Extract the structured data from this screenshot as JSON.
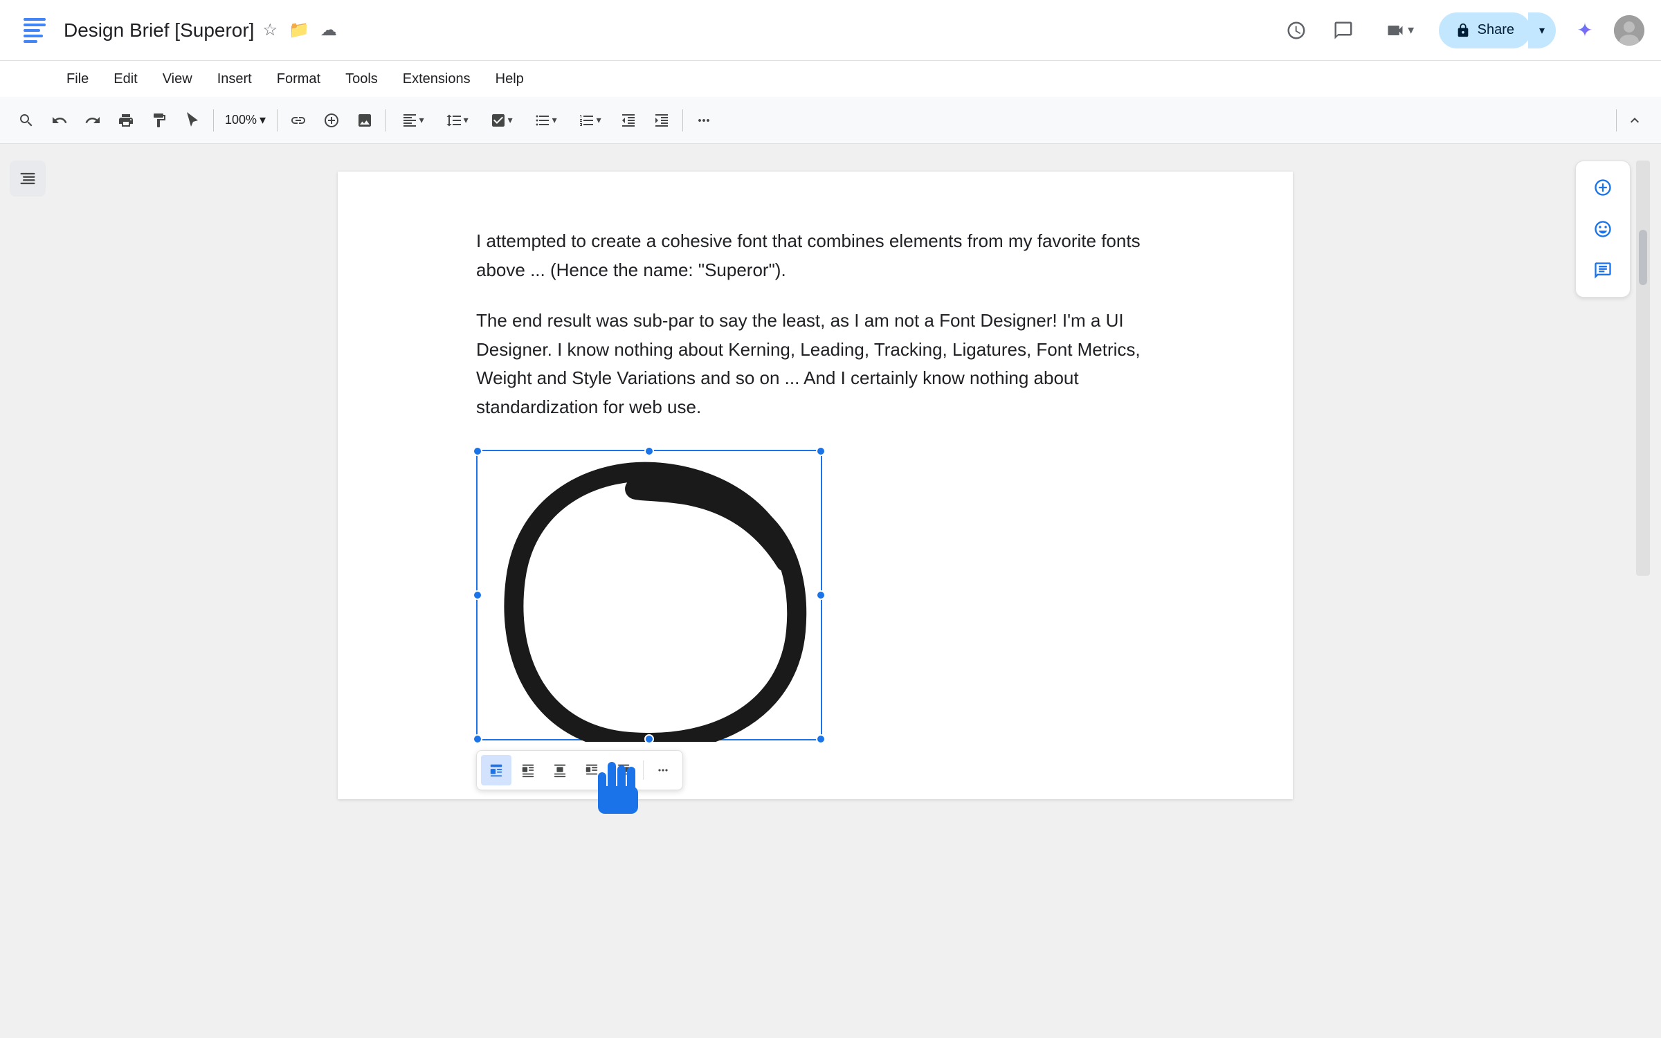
{
  "app": {
    "icon_color": "#4285f4",
    "title": "Design Brief [Superor]",
    "title_icons": {
      "star": "☆",
      "folder": "📁",
      "cloud": "☁"
    }
  },
  "toolbar_top_right": {
    "history_icon": "🕐",
    "comment_icon": "💬",
    "video_icon": "📹",
    "share_label": "Share",
    "share_icon": "🔒",
    "gemini_icon": "✦"
  },
  "menu": {
    "items": [
      "File",
      "Edit",
      "View",
      "Insert",
      "Format",
      "Tools",
      "Extensions",
      "Help"
    ]
  },
  "toolbar": {
    "search_icon": "🔍",
    "undo_icon": "↩",
    "redo_icon": "↪",
    "print_icon": "🖨",
    "paint_icon": "🖌",
    "cursor_icon": "↖",
    "zoom": "100%",
    "link_icon": "🔗",
    "add_icon": "+",
    "image_icon": "🖼",
    "align_icon": "≡",
    "spacing_icon": "↕",
    "checklist_icon": "☑",
    "bullets_icon": "•",
    "numbered_icon": "#",
    "indent_less": "«",
    "indent_more": "»",
    "more_icon": "⋮",
    "collapse_icon": "▲"
  },
  "document": {
    "paragraph1": "I attempted to create a cohesive font that combines elements from my favorite fonts above ...  (Hence the name: \"Superor\").",
    "paragraph2": "The end result was sub-par to say the least, as I am not a Font Designer! I'm a UI Designer. I know nothing about Kerning, Leading, Tracking, Ligatures, Font Metrics, Weight and Style Variations and so on ... And I certainly know nothing about standardization for web use."
  },
  "image_toolbar": {
    "btn_inline": "▣",
    "btn_wrap_left": "◧",
    "btn_wrap_right": "◨",
    "btn_break_left": "◫",
    "btn_break_right": "⊡",
    "more": "⋮"
  },
  "comments_panel": {
    "add_comment": "⊞",
    "emoji": "☺",
    "image_comment": "⊟"
  }
}
